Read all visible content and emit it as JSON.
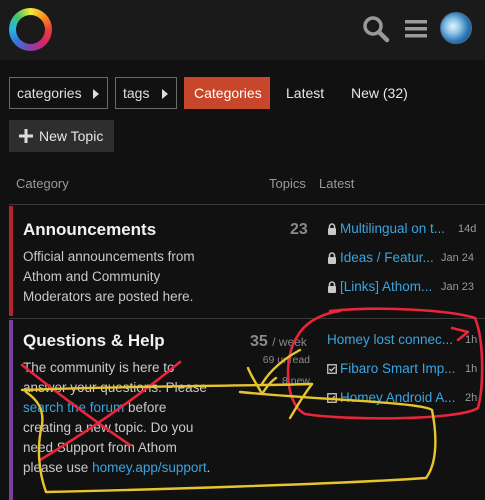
{
  "header": {
    "logo_icon": "app-logo-ring",
    "search_icon": "search-icon",
    "menu_icon": "hamburger-icon",
    "avatar_icon": "user-avatar"
  },
  "nav": {
    "categories_dropdown": "categories",
    "tags_dropdown": "tags",
    "tabs": [
      {
        "label": "Categories",
        "active": true
      },
      {
        "label": "Latest",
        "active": false
      },
      {
        "label": "New (32)",
        "active": false
      }
    ]
  },
  "new_topic_label": "New Topic",
  "columns": {
    "category": "Category",
    "topics": "Topics",
    "latest": "Latest"
  },
  "categories": [
    {
      "title": "Announcements",
      "color": "#b3222e",
      "description": "Official announcements from Athom and Community Moderators are posted here.",
      "topics": "23",
      "latest": [
        {
          "title": "Multilingual on t...",
          "age": "14d",
          "icon": "lock-icon"
        },
        {
          "title": "Ideas / Featur...",
          "age": "Jan 24",
          "icon": "lock-icon"
        },
        {
          "title": "[Links] Athom...",
          "age": "Jan 23",
          "icon": "lock-icon"
        }
      ]
    },
    {
      "title": "Questions & Help",
      "color": "#7b3fa0",
      "desc_1": "The community is here to answer your questions. Please ",
      "desc_link_1": "search the forum",
      "desc_2": " before creating a new topic. Do you need Support from Athom please use ",
      "desc_link_2": "homey.app/support",
      "desc_3": ".",
      "topics": "35",
      "topics_period": "/ week",
      "unread": "69 unread",
      "new_count": "8 new",
      "latest": [
        {
          "title": "Homey lost connec...",
          "age": "1h",
          "icon": "none"
        },
        {
          "title": "Fibaro Smart Imp...",
          "age": "1h",
          "icon": "checkbox-icon"
        },
        {
          "title": "Homey Android A...",
          "age": "2h",
          "icon": "checkbox-icon"
        }
      ]
    }
  ],
  "annotations": {
    "red_marker": "#e8253a",
    "yellow_marker": "#e8c52b"
  }
}
